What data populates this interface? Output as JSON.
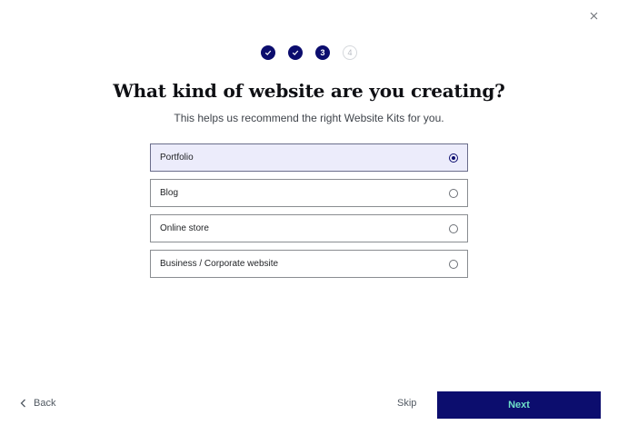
{
  "dialog": {
    "close_icon": "close-icon"
  },
  "stepper": {
    "steps": [
      {
        "status": "done",
        "label": "",
        "icon": "checkmark-icon"
      },
      {
        "status": "done",
        "label": "",
        "icon": "checkmark-icon"
      },
      {
        "status": "active",
        "label": "3"
      },
      {
        "status": "pending",
        "label": "4"
      }
    ]
  },
  "header": {
    "title": "What kind of website are you creating?",
    "subtitle": "This helps us recommend the right Website Kits for you."
  },
  "options": [
    {
      "label": "Portfolio",
      "selected": true
    },
    {
      "label": "Blog",
      "selected": false
    },
    {
      "label": "Online store",
      "selected": false
    },
    {
      "label": "Business / Corporate website",
      "selected": false
    }
  ],
  "footer": {
    "back_label": "Back",
    "back_icon": "chevron-left-icon",
    "skip_label": "Skip",
    "next_label": "Next"
  },
  "colors": {
    "primary": "#0c0d6e",
    "accent_text": "#6ee0c8",
    "selected_bg": "#ececfb"
  }
}
